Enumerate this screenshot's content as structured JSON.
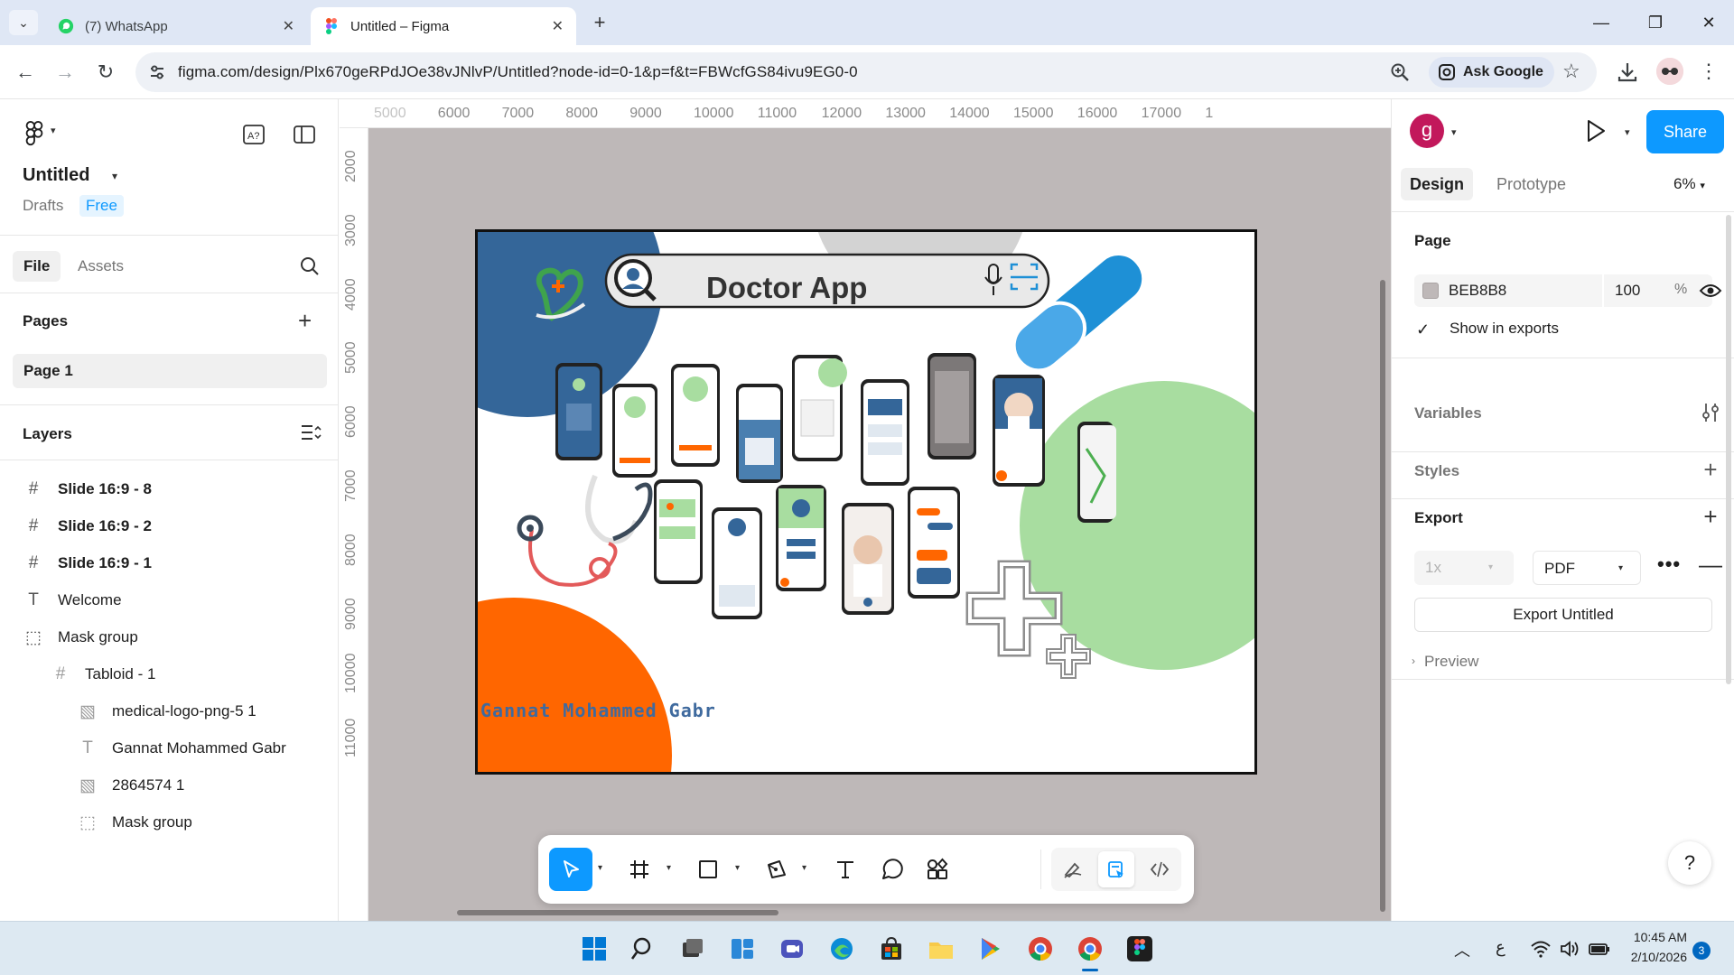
{
  "browser": {
    "tabs": [
      {
        "title": "(7) WhatsApp",
        "icon": "whatsapp-icon",
        "active": false
      },
      {
        "title": "Untitled – Figma",
        "icon": "figma-icon",
        "active": true
      }
    ],
    "url": "figma.com/design/Plx670geRPdJOe38vJNlvP/Untitled?node-id=0-1&p=f&t=FBWcfGS84ivu9EG0-0",
    "ask_google": "Ask Google"
  },
  "left_panel": {
    "file_title": "Untitled",
    "location": "Drafts",
    "plan_badge": "Free",
    "tabs": [
      "File",
      "Assets"
    ],
    "pages_header": "Pages",
    "pages": [
      "Page 1"
    ],
    "layers_header": "Layers",
    "layers": [
      {
        "name": "Slide 16:9 - 8",
        "icon": "frame-icon",
        "indent": 0,
        "bold": true
      },
      {
        "name": "Slide 16:9 - 2",
        "icon": "frame-icon",
        "indent": 0,
        "bold": true
      },
      {
        "name": "Slide 16:9 - 1",
        "icon": "frame-icon",
        "indent": 0,
        "bold": true
      },
      {
        "name": "Welcome",
        "icon": "text-icon",
        "indent": 0,
        "bold": false
      },
      {
        "name": "Mask group",
        "icon": "mask-group-icon",
        "indent": 0,
        "bold": false
      },
      {
        "name": "Tabloid - 1",
        "icon": "frame-icon",
        "indent": 1,
        "bold": false
      },
      {
        "name": "medical-logo-png-5 1",
        "icon": "image-icon",
        "indent": 2,
        "bold": false
      },
      {
        "name": "Gannat Mohammed Gabr",
        "icon": "text-icon",
        "indent": 2,
        "bold": false
      },
      {
        "name": "2864574 1",
        "icon": "image-icon",
        "indent": 2,
        "bold": false
      },
      {
        "name": "Mask group",
        "icon": "mask-group-icon",
        "indent": 2,
        "bold": false
      }
    ]
  },
  "canvas": {
    "background": "#BEB8B8",
    "ruler_x": [
      "5000",
      "6000",
      "7000",
      "8000",
      "9000",
      "10000",
      "11000",
      "12000",
      "13000",
      "14000",
      "15000",
      "16000",
      "17000",
      "1"
    ],
    "ruler_y": [
      "2000",
      "3000",
      "4000",
      "5000",
      "6000",
      "7000",
      "8000",
      "9000",
      "10000",
      "11000"
    ],
    "artboard": {
      "title": "Doctor App",
      "author": "Gannat Mohammed Gabr",
      "colors": {
        "navy": "#346699",
        "orange": "#FF6600",
        "green": "#A8DDA0",
        "gray": "#D3D3D3",
        "pill_blue": "#1E90D6"
      }
    }
  },
  "toolbar": {
    "tools": [
      "move-tool",
      "frame-tool",
      "shape-tool",
      "pen-tool",
      "text-tool",
      "comment-tool",
      "actions-tool"
    ],
    "modes": [
      "draw-mode",
      "design-mode",
      "dev-mode"
    ]
  },
  "right_panel": {
    "avatar_letter": "g",
    "share_label": "Share",
    "tabs": [
      "Design",
      "Prototype"
    ],
    "zoom": "6%",
    "page_header": "Page",
    "page_fill_hex": "BEB8B8",
    "page_fill_opacity": "100",
    "percent_sign": "%",
    "show_in_exports": "Show in exports",
    "variables_header": "Variables",
    "styles_header": "Styles",
    "export_header": "Export",
    "export_scale": "1x",
    "export_format": "PDF",
    "export_button": "Export Untitled",
    "preview_label": "Preview",
    "help": "?"
  },
  "taskbar": {
    "time": "10:45 AM",
    "date": "2/10/2026",
    "notification_count": "3",
    "lang": "ع"
  }
}
